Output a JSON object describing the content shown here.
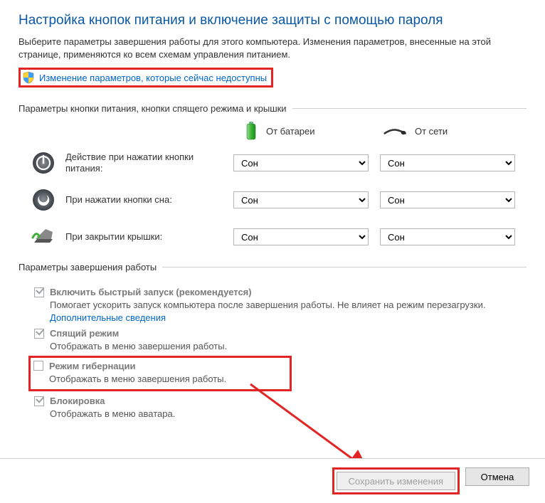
{
  "title": "Настройка кнопок питания и включение защиты с помощью пароля",
  "intro": "Выберите параметры завершения работы для этого компьютера. Изменения параметров, внесенные на этой странице, применяются ко всем схемам управления питанием.",
  "admin_link": "Изменение параметров, которые сейчас недоступны",
  "section_buttons": "Параметры кнопки питания, кнопки спящего режима и крышки",
  "col_battery": "От батареи",
  "col_ac": "От сети",
  "rows": {
    "power": {
      "label": "Действие при нажатии кнопки питания:",
      "batt": "Сон",
      "ac": "Сон"
    },
    "sleep": {
      "label": "При нажатии кнопки сна:",
      "batt": "Сон",
      "ac": "Сон"
    },
    "lid": {
      "label": "При закрытии крышки:",
      "batt": "Сон",
      "ac": "Сон"
    }
  },
  "option_sleep": "Сон",
  "section_shutdown": "Параметры завершения работы",
  "fast": {
    "title": "Включить быстрый запуск (рекомендуется)",
    "desc": "Помогает ускорить запуск компьютера после завершения работы. Не влияет на режим перезагрузки. ",
    "more": "Дополнительные сведения"
  },
  "sleep_opt": {
    "title": "Спящий режим",
    "desc": "Отображать в меню завершения работы."
  },
  "hib_opt": {
    "title": "Режим гибернации",
    "desc": "Отображать в меню завершения работы."
  },
  "lock_opt": {
    "title": "Блокировка",
    "desc": "Отображать в меню аватара."
  },
  "btn_save": "Сохранить изменения",
  "btn_cancel": "Отмена"
}
